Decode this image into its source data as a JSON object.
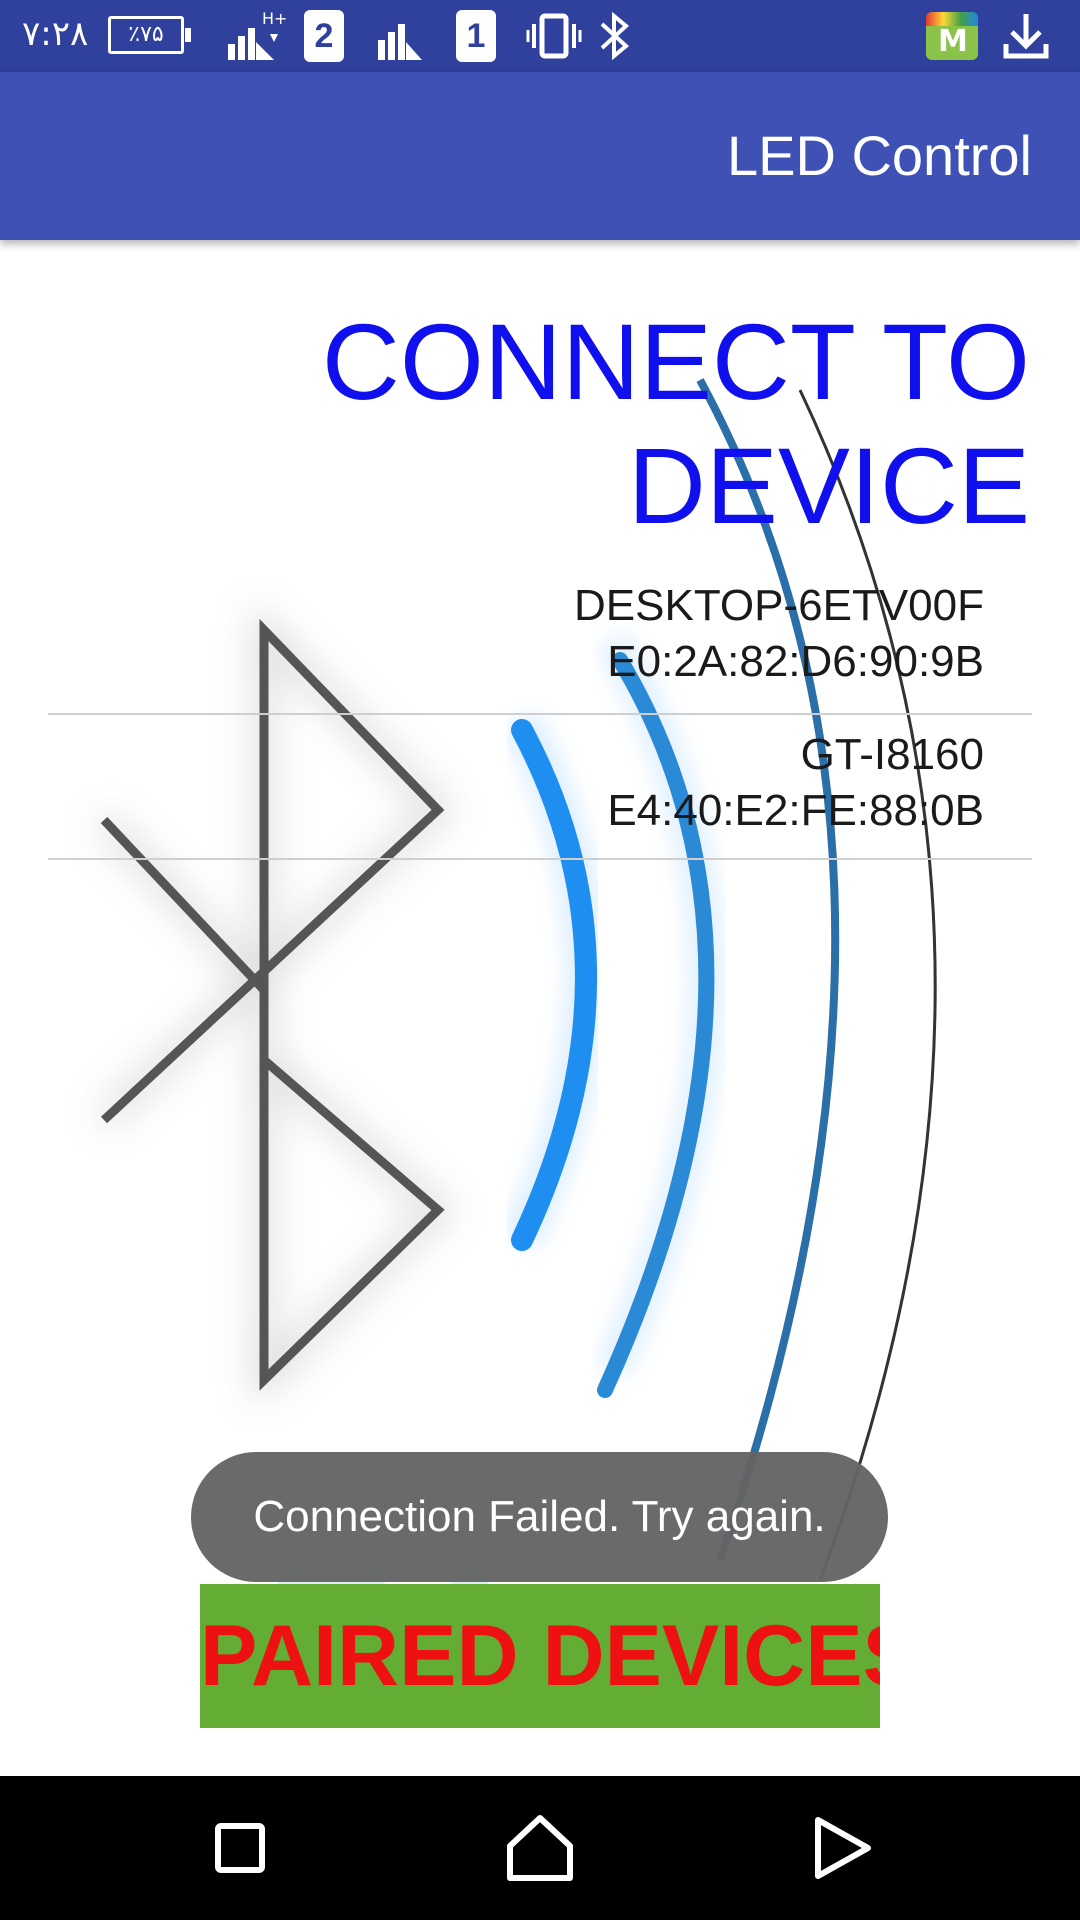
{
  "status_bar": {
    "time": "۷:۲۸",
    "battery_text": "٪۷۵",
    "sim_badges": [
      "2",
      "1"
    ],
    "network_label": "H+",
    "icons": [
      "signal-icon",
      "sim-2-icon",
      "signal-icon",
      "sim-1-icon",
      "vibrate-icon",
      "bluetooth-icon",
      "app-store-icon",
      "download-icon"
    ]
  },
  "app_bar": {
    "title": "LED Control"
  },
  "main": {
    "heading": "CONNECT TO DEVICE",
    "devices": [
      {
        "name": "DESKTOP-6ETV00F",
        "address": "E0:2A:82:D6:90:9B"
      },
      {
        "name": "GT-I8160",
        "address": "E4:40:E2:FE:88:0B"
      }
    ],
    "paired_button_label": "PAIRED DEVICES",
    "background_image": "bluetooth-icon"
  },
  "toast": {
    "message": "Connection Failed. Try again."
  },
  "nav_bar": {
    "buttons": [
      "recents-icon",
      "home-icon",
      "back-icon"
    ]
  },
  "colors": {
    "status_bar": "#30409d",
    "app_bar": "#3f51b5",
    "heading": "#1010ee",
    "paired_button_bg": "#63ad34",
    "paired_button_text": "#ee1111",
    "toast_bg": "#646464"
  }
}
